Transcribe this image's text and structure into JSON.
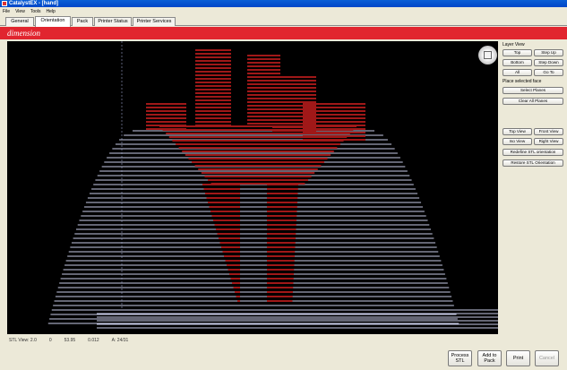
{
  "window": {
    "title": "CatalystEX - [hand]"
  },
  "menu": [
    "File",
    "View",
    "Tools",
    "Help"
  ],
  "tabs": [
    "General",
    "Orientation",
    "Pack",
    "Printer Status",
    "Printer Services"
  ],
  "active_tab": "Orientation",
  "brand": {
    "logo_text": "dimension",
    "color": "#e1252f"
  },
  "right_panel": {
    "layer_view_label": "Layer View",
    "buttons_row1": [
      "Top",
      "Step Up"
    ],
    "buttons_row2": [
      "Bottom",
      "Step Down"
    ],
    "buttons_row3": [
      "All",
      "Go To"
    ],
    "face_label": "Place selected face",
    "select_planes": "Select Planes",
    "clear_planes": "Clear All Planes",
    "view_row1": [
      "Top View",
      "Front View"
    ],
    "view_row2": [
      "Iso View",
      "Right View"
    ],
    "redefine_label": "Redefine STL orientation",
    "restore_label": "Restore STL Orientation"
  },
  "status_line": [
    "STL View: 2.0",
    "0",
    "53.95",
    "0.012",
    "A: 24/31"
  ],
  "bottom_buttons": [
    "Process STL",
    "Add to Pack",
    "Print",
    "Cancel"
  ],
  "colors": {
    "model_layer": "#a01818",
    "support_layer": "#c8cde8",
    "viewport": "#000000"
  }
}
